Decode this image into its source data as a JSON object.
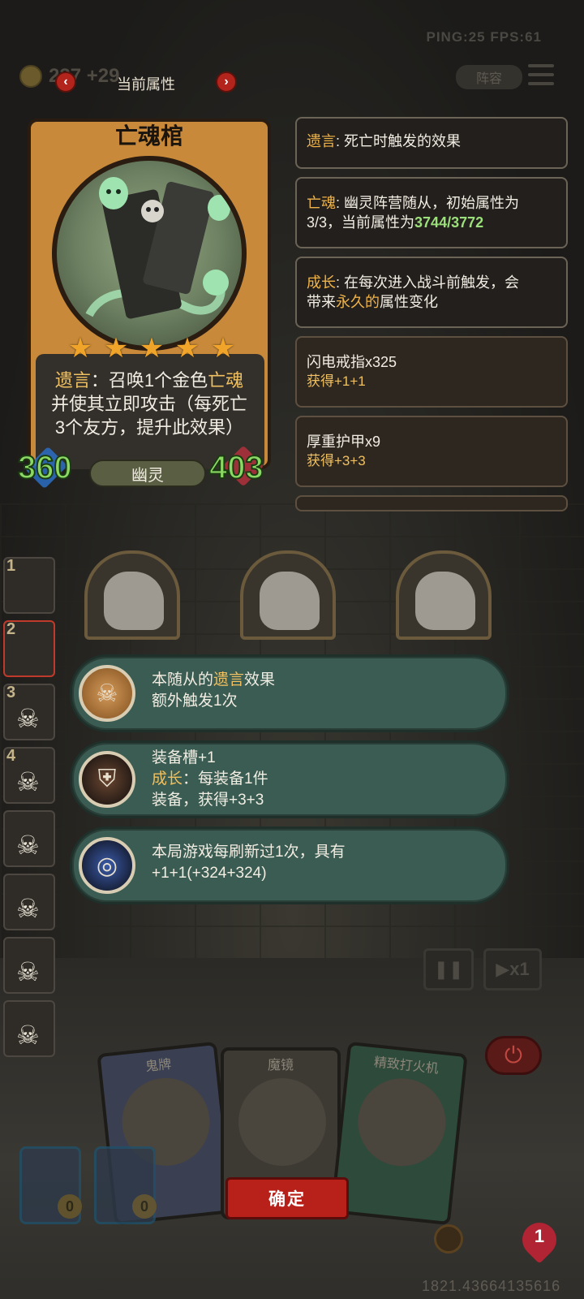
{
  "hud": {
    "ping_fps": "PING:25   FPS:61",
    "gold": "237 +29",
    "lineup_label": "阵容"
  },
  "header": {
    "title": "当前属性",
    "prev_icon": "chevron-left-icon",
    "next_icon": "chevron-right-icon"
  },
  "card": {
    "name": "亡魂棺",
    "stars": 5,
    "desc_1a": "遗言",
    "desc_1b": "：召唤1个金色",
    "desc_1c": "亡魂",
    "desc_2": "并使其立即攻击（每死亡",
    "desc_3": "3个友方，提升此效果）",
    "attack": "360",
    "health": "403",
    "type": "幽灵"
  },
  "panels": {
    "p1_key": "遗言",
    "p1_text": ": 死亡时触发的效果",
    "p2_key": "亡魂",
    "p2_text": ": 幽灵阵营随从，初始属性为",
    "p2_text2": "3/3，当前属性为",
    "p2_value": "3744/3772",
    "p3_key": "成长",
    "p3_text": ": 在每次进入战斗前触发，会",
    "p3_text2": "带来",
    "p3_highlight": "永久的",
    "p3_text3": "属性变化"
  },
  "gear": [
    {
      "name": "闪电戒指x325",
      "bonus": "获得+1+1"
    },
    {
      "name": "厚重护甲x9",
      "bonus": "获得+3+3"
    }
  ],
  "side_slots": [
    "1",
    "2",
    "3",
    "4",
    "",
    "",
    "",
    ""
  ],
  "effects": {
    "e1_line1a": "本随从的",
    "e1_line1b": "遗言",
    "e1_line1c": "效果",
    "e1_line2": "额外触发1次",
    "e2_line1": "装备槽+1",
    "e2_line2a": "成长",
    "e2_line2b": "：每装备1件",
    "e2_line3": "装备，获得+3+3",
    "e3_line1": "本局游戏每刷新过1次，具有",
    "e3_line2": "+1+1(+324+324)"
  },
  "controls": {
    "speed_label": "x1"
  },
  "shop": {
    "cards": [
      "鬼牌",
      "魔镜",
      "精致打火机"
    ],
    "confirm_label": "确定"
  },
  "bottom": {
    "hero_coin_1": "0",
    "hero_coin_2": "0",
    "lives": "1",
    "seed": "1821.43664135616"
  },
  "colors": {
    "accent_gold": "#f0c060",
    "stat_green": "#8cd864",
    "confirm_red": "#b8201a",
    "effect_teal": "#3a5c52"
  }
}
